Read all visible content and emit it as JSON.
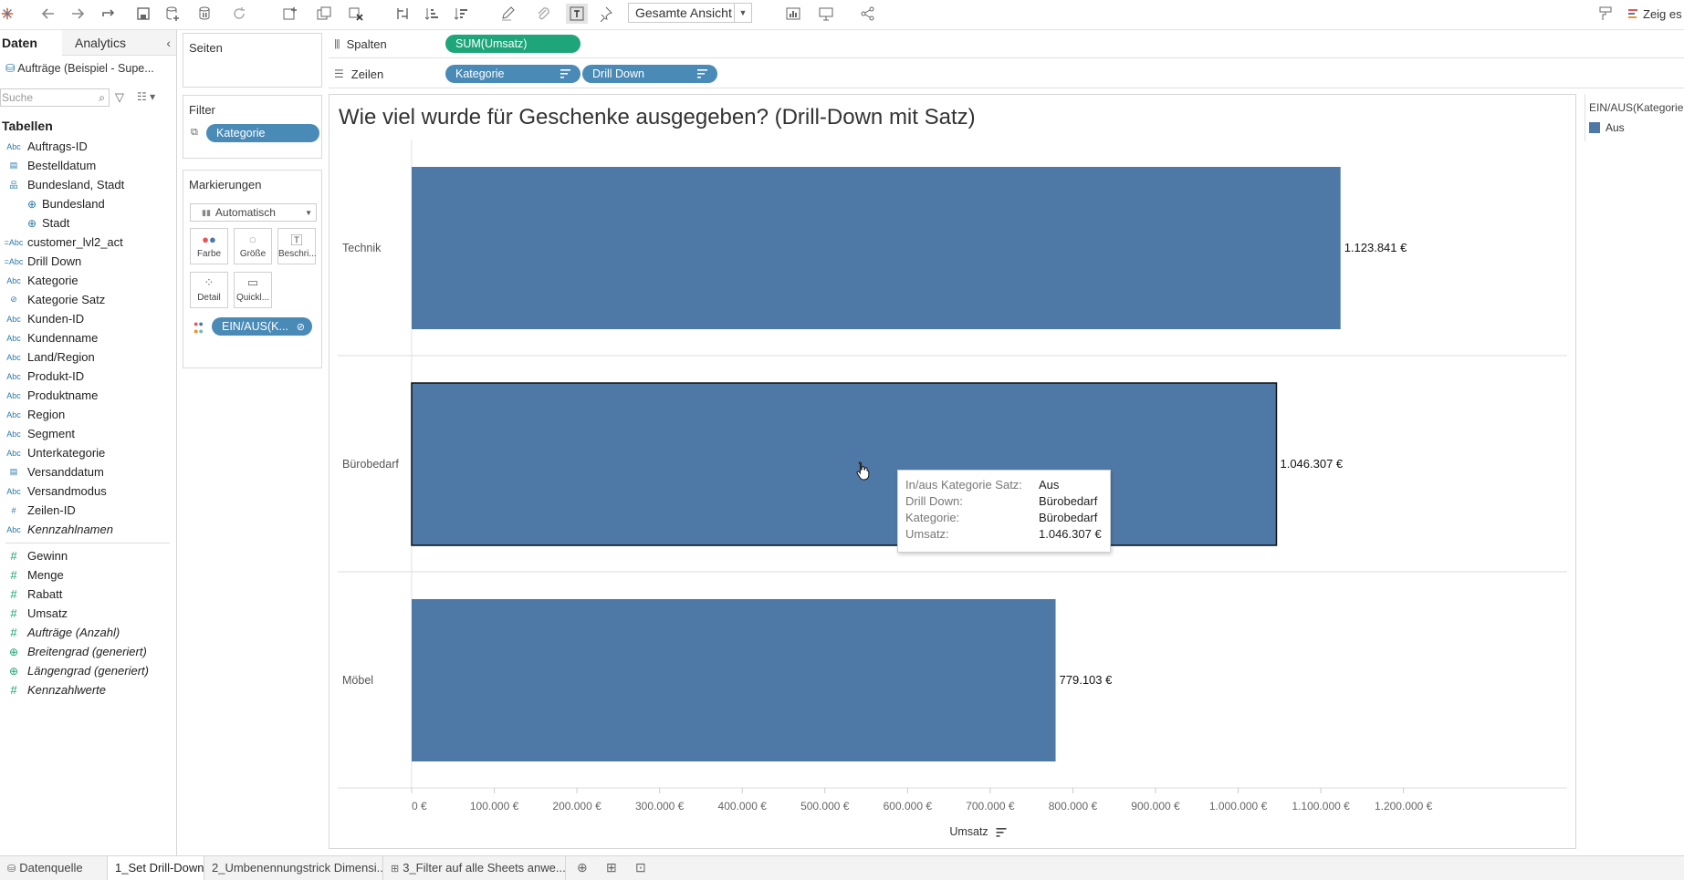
{
  "toolbar": {
    "view_select": "Gesamte Ansicht",
    "right_label": "Zeig es"
  },
  "left_pane": {
    "tab_daten": "Daten",
    "tab_analytics": "Analytics",
    "datasource": "Aufträge (Beispiel - Supe...",
    "search_placeholder": "Suche",
    "tables_heading": "Tabellen",
    "dimensions": [
      {
        "icon": "Abc",
        "label": "Auftrags-ID"
      },
      {
        "icon": "calendar",
        "label": "Bestelldatum"
      },
      {
        "icon": "hierarchy",
        "label": "Bundesland, Stadt"
      },
      {
        "icon": "globe",
        "label": "Bundesland",
        "indent": true
      },
      {
        "icon": "globe",
        "label": "Stadt",
        "indent": true
      },
      {
        "icon": "=Abc",
        "label": "customer_lvl2_act"
      },
      {
        "icon": "=Abc",
        "label": "Drill Down"
      },
      {
        "icon": "Abc",
        "label": "Kategorie"
      },
      {
        "icon": "set",
        "label": "Kategorie Satz"
      },
      {
        "icon": "Abc",
        "label": "Kunden-ID"
      },
      {
        "icon": "Abc",
        "label": "Kundenname"
      },
      {
        "icon": "Abc",
        "label": "Land/Region"
      },
      {
        "icon": "Abc",
        "label": "Produkt-ID"
      },
      {
        "icon": "Abc",
        "label": "Produktname"
      },
      {
        "icon": "Abc",
        "label": "Region"
      },
      {
        "icon": "Abc",
        "label": "Segment"
      },
      {
        "icon": "Abc",
        "label": "Unterkategorie"
      },
      {
        "icon": "calendar",
        "label": "Versanddatum"
      },
      {
        "icon": "Abc",
        "label": "Versandmodus"
      },
      {
        "icon": "#",
        "label": "Zeilen-ID"
      },
      {
        "icon": "Abc",
        "label": "Kennzahlnamen",
        "italic": true
      }
    ],
    "measures": [
      {
        "icon": "#",
        "label": "Gewinn"
      },
      {
        "icon": "#",
        "label": "Menge"
      },
      {
        "icon": "#",
        "label": "Rabatt"
      },
      {
        "icon": "#",
        "label": "Umsatz"
      },
      {
        "icon": "#",
        "label": "Aufträge (Anzahl)",
        "italic": true
      },
      {
        "icon": "globe",
        "label": "Breitengrad (generiert)",
        "italic": true
      },
      {
        "icon": "globe",
        "label": "Längengrad (generiert)",
        "italic": true
      },
      {
        "icon": "#",
        "label": "Kennzahlwerte",
        "italic": true
      }
    ]
  },
  "cards": {
    "pages_title": "Seiten",
    "filter_title": "Filter",
    "filter_pill": "Kategorie",
    "marks_title": "Markierungen",
    "marks_type": "Automatisch",
    "mark_buttons": [
      "Farbe",
      "Größe",
      "Beschri...",
      "Detail",
      "Quickl..."
    ],
    "color_pill": "EIN/AUS(K..."
  },
  "shelves": {
    "columns_label": "Spalten",
    "columns_pill": "SUM(Umsatz)",
    "rows_label": "Zeilen",
    "rows_pills": [
      "Kategorie",
      "Drill Down"
    ]
  },
  "view": {
    "title": "Wie viel wurde für Geschenke ausgegeben? (Drill-Down mit Satz)"
  },
  "legend": {
    "title": "EIN/AUS(Kategorie",
    "item": "Aus",
    "color": "#4e79a7"
  },
  "tooltip": {
    "rows": [
      {
        "key": "In/aus Kategorie Satz:",
        "value": "Aus"
      },
      {
        "key": "Drill Down:",
        "value": "Bürobedarf"
      },
      {
        "key": "Kategorie:",
        "value": "Bürobedarf"
      },
      {
        "key": "Umsatz:",
        "value": "1.046.307 €"
      }
    ]
  },
  "chart_data": {
    "type": "bar",
    "orientation": "horizontal",
    "categories": [
      "Technik",
      "Bürobedarf",
      "Möbel"
    ],
    "values": [
      1123841,
      1046307,
      779103
    ],
    "data_labels": [
      "1.123.841 €",
      "1.046.307 €",
      "779.103 €"
    ],
    "xlim": [
      0,
      1260000
    ],
    "x_ticks": [
      0,
      100000,
      200000,
      300000,
      400000,
      500000,
      600000,
      700000,
      800000,
      900000,
      1000000,
      1100000,
      1200000
    ],
    "x_tick_labels": [
      "0 €",
      "100.000 €",
      "200.000 €",
      "300.000 €",
      "400.000 €",
      "500.000 €",
      "600.000 €",
      "700.000 €",
      "800.000 €",
      "900.000 €",
      "1.000.000 €",
      "1.100.000 €",
      "1.200.000 €"
    ],
    "xlabel": "Umsatz",
    "bar_color": "#4e79a7",
    "selected_category": "Bürobedarf"
  },
  "bottom_tabs": {
    "datasource": "Datenquelle",
    "sheets": [
      "1_Set Drill-Down",
      "2_Umbenennungstrick Dimensi...",
      "3_Filter auf alle Sheets anwe..."
    ]
  }
}
